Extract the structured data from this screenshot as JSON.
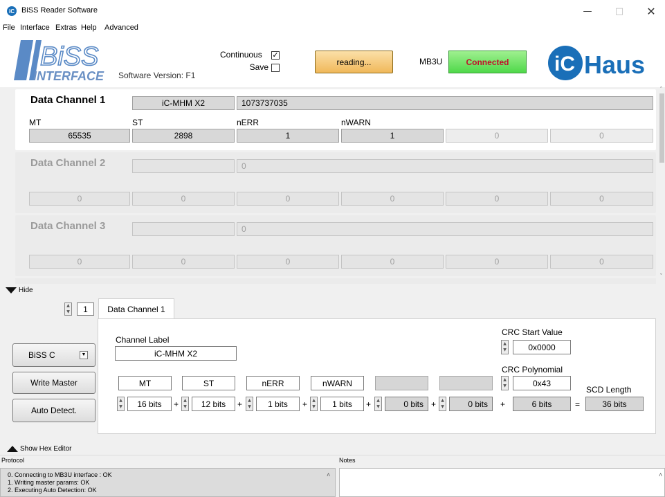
{
  "window": {
    "title": "BiSS Reader Software",
    "icon_text": "iC"
  },
  "menu": [
    "File",
    "Interface",
    "Extras",
    "Help",
    "Advanced"
  ],
  "header": {
    "logo_top": "BiSS",
    "logo_bottom": "INTERFACE",
    "software_version": "Software Version:  F1",
    "continuous_label": "Continuous",
    "continuous_checked": true,
    "save_label": "Save",
    "save_checked": false,
    "reading_button": "reading...",
    "interface_name": "MB3U",
    "status": "Connected",
    "company_logo": "Haus",
    "company_logo_prefix": "iC"
  },
  "channels": [
    {
      "title": "Data Channel 1",
      "label": "iC-MHM X2",
      "raw": "1073737035",
      "columns": [
        "MT",
        "ST",
        "nERR",
        "nWARN"
      ],
      "values": [
        "65535",
        "2898",
        "1",
        "1",
        "0",
        "0"
      ],
      "active": true
    },
    {
      "title": "Data Channel 2",
      "label": "",
      "raw": "0",
      "values": [
        "0",
        "0",
        "0",
        "0",
        "0",
        "0"
      ],
      "active": false
    },
    {
      "title": "Data Channel 3",
      "label": "",
      "raw": "0",
      "values": [
        "0",
        "0",
        "0",
        "0",
        "0",
        "0"
      ],
      "active": false
    }
  ],
  "hide_label": "Hide",
  "channel_selector": "1",
  "tab_label": "Data Channel 1",
  "config": {
    "biss_mode": "BiSS C",
    "write_master": "Write Master",
    "auto_detect": "Auto Detect.",
    "channel_label_caption": "Channel Label",
    "channel_label_value": "iC-MHM X2",
    "crc_start_caption": "CRC Start Value",
    "crc_start_value": "0x0000",
    "crc_poly_caption": "CRC Polynomial",
    "crc_poly_value": "0x43",
    "scd_caption": "SCD Length",
    "field_names": [
      "MT",
      "ST",
      "nERR",
      "nWARN",
      "",
      ""
    ],
    "field_bits": [
      "16 bits",
      "12 bits",
      "1 bits",
      "1 bits",
      "0 bits",
      "0 bits"
    ],
    "crc_bits": "6 bits",
    "scd_length": "36 bits",
    "plus": "+",
    "equals": "="
  },
  "hex_editor_label": "Show Hex Editor",
  "protocol": {
    "caption": "Protocol",
    "lines": [
      "0. Connecting to MB3U interface : OK",
      "1. Writing master params: OK",
      "2. Executing Auto Detection: OK"
    ]
  },
  "notes_caption": "Notes"
}
